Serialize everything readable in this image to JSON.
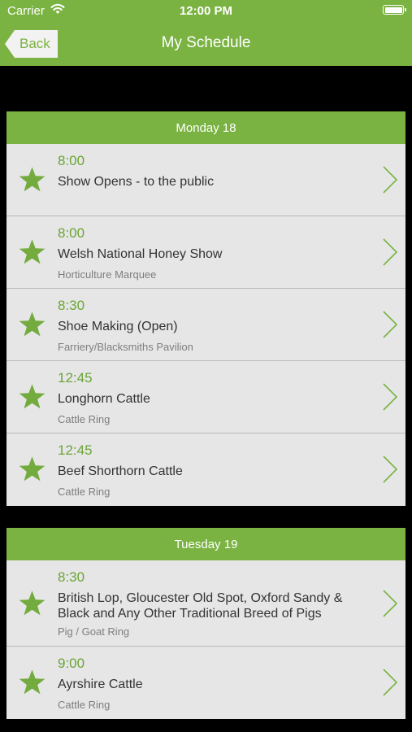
{
  "status_bar": {
    "carrier": "Carrier",
    "time": "12:00 PM"
  },
  "nav": {
    "back_label": "Back",
    "title": "My Schedule"
  },
  "sections": [
    {
      "header": "Monday 18",
      "items": [
        {
          "time": "8:00",
          "title": "Show Opens - to the public",
          "location": ""
        },
        {
          "time": "8:00",
          "title": "Welsh National Honey Show",
          "location": "Horticulture Marquee"
        },
        {
          "time": "8:30",
          "title": "Shoe Making (Open)",
          "location": "Farriery/Blacksmiths Pavilion"
        },
        {
          "time": "12:45",
          "title": "Longhorn Cattle",
          "location": "Cattle Ring"
        },
        {
          "time": "12:45",
          "title": "Beef Shorthorn Cattle",
          "location": "Cattle Ring"
        }
      ]
    },
    {
      "header": "Tuesday 19",
      "items": [
        {
          "time": "8:30",
          "title": "British Lop, Gloucester Old Spot, Oxford Sandy & Black and Any Other Traditional Breed of Pigs",
          "location": "Pig / Goat Ring"
        },
        {
          "time": "9:00",
          "title": "Ayrshire Cattle",
          "location": "Cattle Ring"
        }
      ]
    }
  ],
  "colors": {
    "accent": "#7ab342",
    "row_bg": "#e6e6e6",
    "background": "#000000"
  },
  "icons": {
    "favorite": "star-icon",
    "disclosure": "chevron-right-icon"
  }
}
